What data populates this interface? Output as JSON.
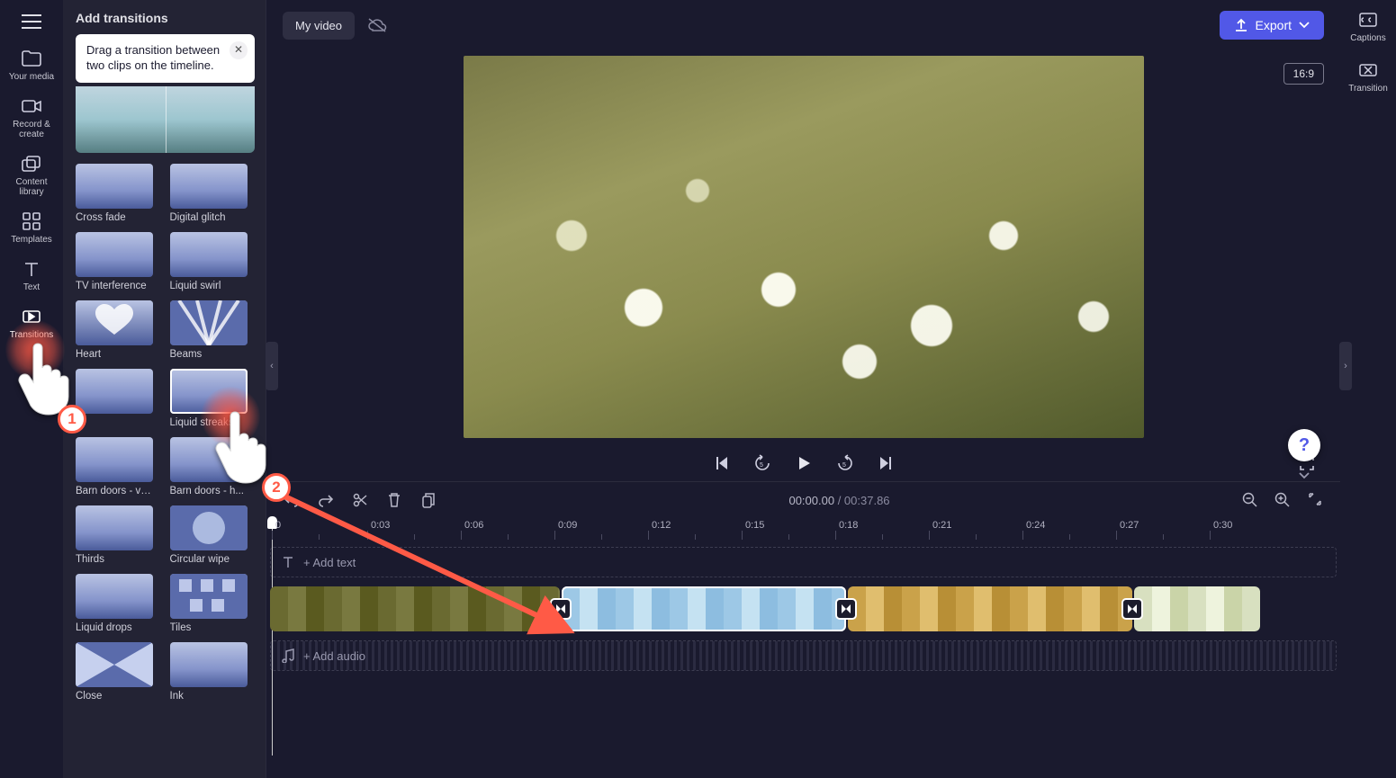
{
  "leftrail": {
    "items": [
      {
        "id": "your-media",
        "label": "Your media"
      },
      {
        "id": "record-create",
        "label": "Record & create"
      },
      {
        "id": "content-library",
        "label": "Content library"
      },
      {
        "id": "templates",
        "label": "Templates"
      },
      {
        "id": "text",
        "label": "Text"
      },
      {
        "id": "transitions",
        "label": "Transitions"
      }
    ]
  },
  "panel": {
    "title": "Add transitions",
    "tooltip": "Drag a transition between two clips on the timeline.",
    "transitions": [
      {
        "label": "Cross fade"
      },
      {
        "label": "Digital glitch"
      },
      {
        "label": "TV interference"
      },
      {
        "label": "Liquid swirl"
      },
      {
        "label": "Heart"
      },
      {
        "label": "Beams"
      },
      {
        "label": ""
      },
      {
        "label": "Liquid streaks"
      },
      {
        "label": "Barn doors - ve..."
      },
      {
        "label": "Barn doors - h..."
      },
      {
        "label": "Thirds"
      },
      {
        "label": "Circular wipe"
      },
      {
        "label": "Liquid drops"
      },
      {
        "label": "Tiles"
      },
      {
        "label": "Close"
      },
      {
        "label": "Ink"
      }
    ]
  },
  "topbar": {
    "project_name": "My video",
    "export": "Export"
  },
  "preview": {
    "aspect": "16:9"
  },
  "rightrail": {
    "items": [
      {
        "id": "captions",
        "label": "Captions"
      },
      {
        "id": "transition",
        "label": "Transition"
      }
    ]
  },
  "playback": {
    "current": "00:00.00",
    "separator": " / ",
    "duration": "00:37.86"
  },
  "timeline": {
    "add_text": "+ Add text",
    "add_audio": "+ Add audio",
    "ruler": [
      "0",
      "0:03",
      "0:06",
      "0:09",
      "0:12",
      "0:15",
      "0:18",
      "0:21",
      "0:24",
      "0:27",
      "0:30"
    ]
  },
  "tutorial": {
    "step1": "1",
    "step2": "2"
  },
  "help": "?",
  "colors": {
    "accent": "#5158e7",
    "tutorial": "#ff5a46"
  }
}
